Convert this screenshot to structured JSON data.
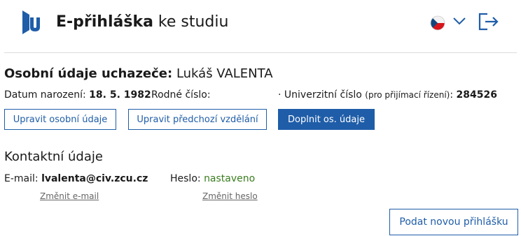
{
  "header": {
    "title_bold": "E-přihláška",
    "title_rest": " ke studiu",
    "language_flag": "czech-flag",
    "colors": {
      "brand": "#1f5da8",
      "accent_green": "#3a7d1e"
    }
  },
  "personal": {
    "title_label": "Osobní údaje uchazeče:",
    "applicant_name": " Lukáš VALENTA",
    "birth_label": "Datum narození: ",
    "birth_value": "18. 5. 1982",
    "rc_label": "Rodné číslo:",
    "univ_bullet": "· ",
    "univ_label": "Univerzitní číslo ",
    "univ_note": "(pro přijímací řízení)",
    "univ_colon": ": ",
    "univ_value": "284526",
    "buttons": {
      "edit_personal": "Upravit osobní údaje",
      "edit_education": "Upravit předchozí vzdělání",
      "complete": "Doplnit os. údaje"
    }
  },
  "contact": {
    "title": "Kontaktní údaje",
    "email_label": "E-mail: ",
    "email_value": "lvalenta@civ.zcu.cz",
    "password_label": "Heslo: ",
    "password_value": "nastaveno",
    "change_email": "Změnit e-mail",
    "change_password": "Změnit heslo"
  },
  "actions": {
    "new_application": "Podat novou přihlášku"
  }
}
